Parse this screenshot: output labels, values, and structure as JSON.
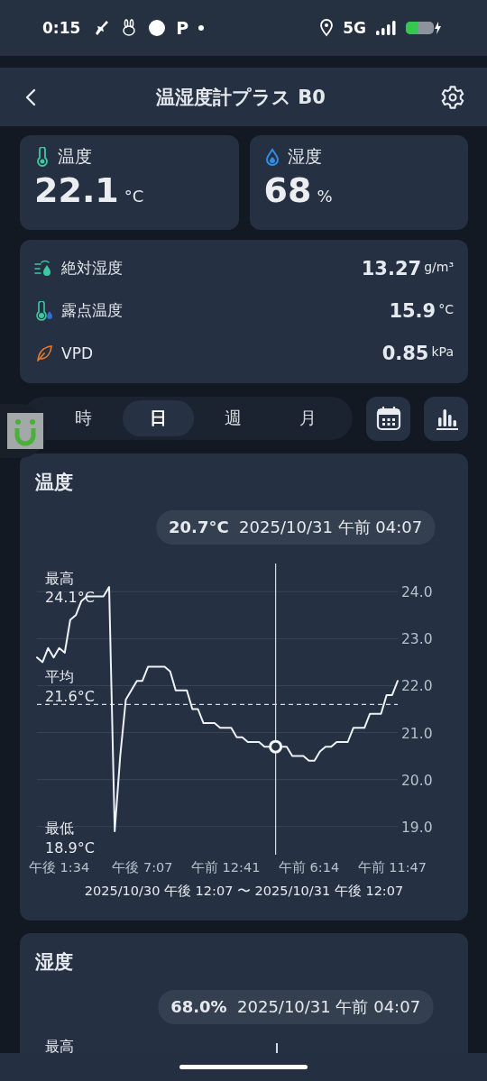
{
  "status_bar": {
    "time": "0:15",
    "app_badge": "P",
    "network": "5G"
  },
  "header": {
    "title": "温湿度計プラス B0"
  },
  "readings": [
    {
      "kind": "temperature",
      "label": "温度",
      "value": "22.1",
      "unit": "°C"
    },
    {
      "kind": "humidity",
      "label": "湿度",
      "value": "68",
      "unit": "%"
    }
  ],
  "details": [
    {
      "kind": "absolute",
      "label": "絶対湿度",
      "value": "13.27",
      "unit": "g/m³"
    },
    {
      "kind": "dew",
      "label": "露点温度",
      "value": "15.9",
      "unit": "°C"
    },
    {
      "kind": "vpd",
      "label": "VPD",
      "value": "0.85",
      "unit": "kPa"
    }
  ],
  "periods": [
    {
      "label": "時",
      "selected": false
    },
    {
      "label": "日",
      "selected": true
    },
    {
      "label": "週",
      "selected": false
    },
    {
      "label": "月",
      "selected": false
    }
  ],
  "temperature_chart": {
    "title": "温度",
    "tooltip_value": "20.7°C",
    "tooltip_time": "2025/10/31 午前 04:07",
    "stats": [
      {
        "label": "最高",
        "value": "24.1°C"
      },
      {
        "label": "平均",
        "value": "21.6°C"
      },
      {
        "label": "最低",
        "value": "18.9°C"
      }
    ],
    "range": "2025/10/30 午後 12:07 〜 2025/10/31 午後 12:07",
    "chart_data": {
      "type": "line",
      "categories": [
        null,
        null,
        null,
        null,
        "午後 1:34",
        null,
        null,
        null,
        null,
        null,
        null,
        null,
        null,
        null,
        null,
        null,
        null,
        null,
        null,
        "午後 7:07",
        null,
        null,
        null,
        null,
        null,
        null,
        null,
        null,
        null,
        null,
        null,
        null,
        null,
        null,
        "午前 12:41",
        null,
        null,
        null,
        null,
        null,
        null,
        null,
        null,
        null,
        null,
        null,
        null,
        null,
        null,
        "午前 6:14",
        null,
        null,
        null,
        null,
        null,
        null,
        null,
        null,
        null,
        null,
        null,
        null,
        null,
        null,
        "午前 11:47",
        null
      ],
      "series": [
        {
          "color": "#eef1f5",
          "values": [
            22.6,
            22.5,
            22.8,
            22.6,
            22.8,
            22.7,
            23.4,
            23.5,
            23.8,
            23.9,
            23.9,
            23.9,
            23.9,
            24.1,
            18.9,
            20.5,
            21.7,
            21.9,
            22.1,
            22.1,
            22.4,
            22.4,
            22.4,
            22.4,
            22.3,
            21.9,
            21.9,
            21.9,
            21.5,
            21.5,
            21.2,
            21.2,
            21.2,
            21.1,
            21.1,
            21.1,
            20.9,
            20.9,
            20.8,
            20.8,
            20.8,
            20.7,
            20.7,
            20.7,
            20.7,
            20.7,
            20.5,
            20.5,
            20.5,
            20.4,
            20.4,
            20.6,
            20.7,
            20.7,
            20.8,
            20.8,
            20.8,
            21.1,
            21.1,
            21.1,
            21.4,
            21.4,
            21.4,
            21.8,
            21.8,
            22.1
          ]
        }
      ],
      "ylim": [
        18.4,
        24.6
      ],
      "grid": true,
      "ref_lines": [
        {
          "axis": "y",
          "value": 21.6
        }
      ],
      "yticks": [
        {
          "value": 19,
          "label": "19.0"
        },
        {
          "value": 20,
          "label": "20.0"
        },
        {
          "value": 21,
          "label": "21.0"
        },
        {
          "value": 22,
          "label": "22.0"
        },
        {
          "value": 23,
          "label": "23.0"
        },
        {
          "value": 24,
          "label": "24.0"
        }
      ]
    }
  },
  "humidity_chart": {
    "title": "湿度",
    "tooltip_value": "68.0%",
    "tooltip_time": "2025/10/31 午前 04:07",
    "stats": [
      {
        "label": "最高"
      }
    ]
  }
}
